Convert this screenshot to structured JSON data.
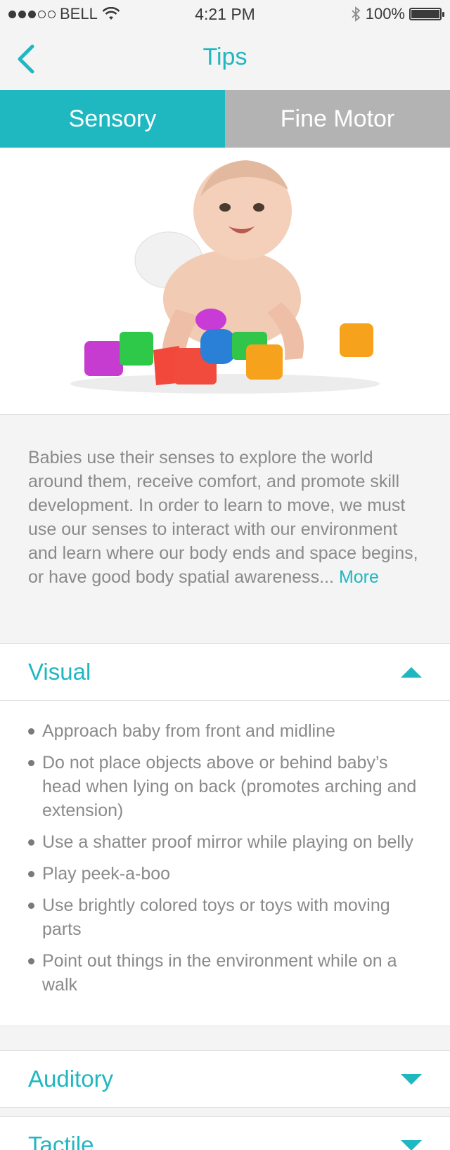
{
  "status_bar": {
    "carrier": "BELL",
    "time": "4:21 PM",
    "battery": "100%",
    "battery_level": 1.0,
    "signal_bars_filled": 3,
    "signal_bars_total": 5
  },
  "nav": {
    "title": "Tips"
  },
  "tabs": [
    {
      "label": "Sensory",
      "active": true
    },
    {
      "label": "Fine Motor",
      "active": false
    }
  ],
  "intro": {
    "text": "Babies use their senses to explore the world around them, receive comfort, and promote skill development. In order to learn to move, we must use our senses to interact with our environment and learn where our body ends and space begins, or have good body spatial awareness... ",
    "more_label": "More"
  },
  "sections": [
    {
      "title": "Visual",
      "expanded": true,
      "tips": [
        "Approach baby from front and midline",
        "Do not place objects above or behind baby’s head when lying on back (promotes arching and extension)",
        "Use a shatter proof mirror while playing on belly",
        "Play peek-a-boo",
        "Use brightly colored toys or toys with moving parts",
        "Point out things in the environment while on a walk"
      ]
    },
    {
      "title": "Auditory",
      "expanded": false
    },
    {
      "title": "Tactile",
      "expanded": false
    }
  ],
  "colors": {
    "accent": "#1fb7c0",
    "tab_inactive": "#b3b3b3",
    "text": "#8a8a8a",
    "background": "#f4f4f4"
  }
}
